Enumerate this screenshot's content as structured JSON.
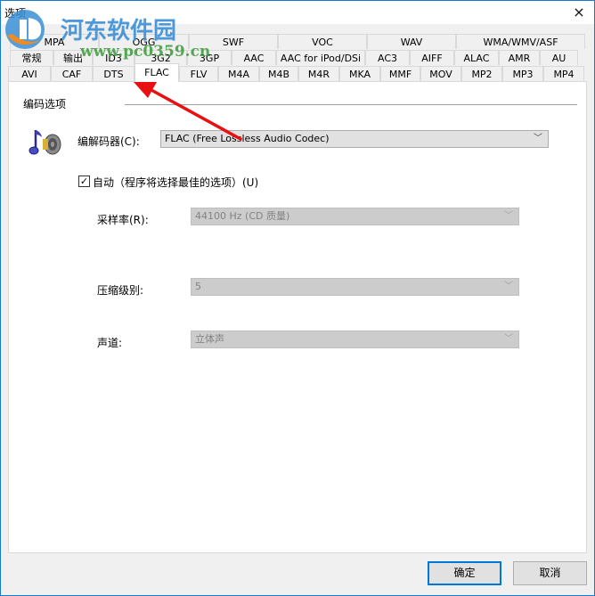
{
  "window": {
    "title": "选项",
    "close_icon": "×"
  },
  "tabs": {
    "row1": [
      {
        "label": "MPA"
      },
      {
        "label": "OGG"
      },
      {
        "label": "SWF"
      },
      {
        "label": "VOC"
      },
      {
        "label": "WAV"
      },
      {
        "label": "WMA/WMV/ASF"
      }
    ],
    "row2": [
      {
        "label": "常规"
      },
      {
        "label": "输出"
      },
      {
        "label": "ID3"
      },
      {
        "label": "3G2"
      },
      {
        "label": "3GP"
      },
      {
        "label": "AAC"
      },
      {
        "label": "AAC for iPod/DSi"
      },
      {
        "label": "AC3"
      },
      {
        "label": "AIFF"
      },
      {
        "label": "ALAC"
      },
      {
        "label": "AMR"
      },
      {
        "label": "AU"
      }
    ],
    "row3": [
      {
        "label": "AVI"
      },
      {
        "label": "CAF"
      },
      {
        "label": "DTS"
      },
      {
        "label": "FLAC"
      },
      {
        "label": "FLV"
      },
      {
        "label": "M4A"
      },
      {
        "label": "M4B"
      },
      {
        "label": "M4R"
      },
      {
        "label": "MKA"
      },
      {
        "label": "MMF"
      },
      {
        "label": "MOV"
      },
      {
        "label": "MP2"
      },
      {
        "label": "MP3"
      },
      {
        "label": "MP4"
      }
    ],
    "selected": "FLAC"
  },
  "panel": {
    "group_title": "编码选项",
    "codec": {
      "label": "编解码器(C):",
      "value": "FLAC (Free Lossless Audio Codec)"
    },
    "auto": {
      "label": "自动（程序将选择最佳的选项）(U)",
      "checked": true,
      "check_glyph": "✓"
    },
    "sample_rate": {
      "label": "采样率(R):",
      "value": "44100 Hz (CD 质量)",
      "enabled": false
    },
    "compression": {
      "label": "压缩级别:",
      "value": "5",
      "enabled": false
    },
    "channels": {
      "label": "声道:",
      "value": "立体声",
      "enabled": false
    },
    "dropdown_glyph": "﹀"
  },
  "buttons": {
    "ok": "确定",
    "cancel": "取消"
  },
  "watermark": {
    "name": "河东软件园",
    "url": "www.pc0359.cn"
  },
  "annotation": {
    "arrow_color": "#e81010"
  }
}
